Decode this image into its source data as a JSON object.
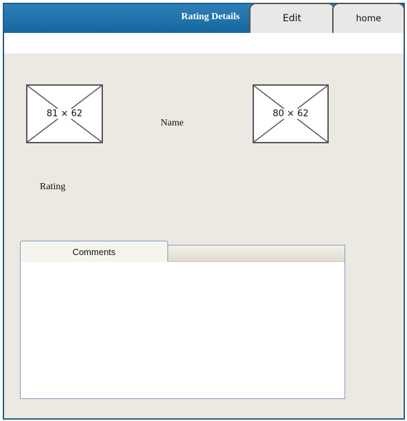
{
  "header": {
    "title": "Rating Details",
    "tabs": [
      {
        "label": "Edit"
      },
      {
        "label": "home"
      }
    ]
  },
  "main": {
    "image_left": {
      "label": "81 × 62"
    },
    "image_right": {
      "label": "80 × 62"
    },
    "name_label": "Name",
    "rating_label": "Rating",
    "comments": {
      "tab_label": "Comments"
    }
  },
  "colors": {
    "title_bar": "#16679f",
    "frame_border": "#1f5f8f",
    "background": "#ece9e3",
    "panel_border": "#7a9bbd"
  }
}
